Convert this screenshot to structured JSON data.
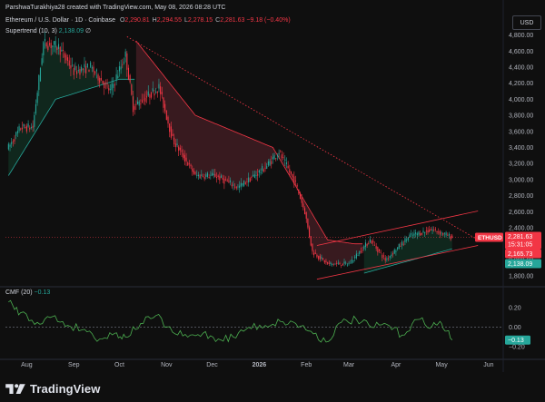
{
  "header": {
    "created_by": "ParshwaTurakhiya28 created with TradingView.com, May 08, 2026 08:28 UTC",
    "symbol_title": "Ethereum / U.S. Dollar · 1D · Coinbase",
    "ohlc": [
      {
        "key": "O",
        "value": "2,290.81"
      },
      {
        "key": "H",
        "value": "2,294.55"
      },
      {
        "key": "L",
        "value": "2,278.15"
      },
      {
        "key": "C",
        "value": "2,281.63"
      }
    ],
    "change": "−9.18 (−0.40%)",
    "supertrend_label": "Supertrend (10, 3)",
    "supertrend_value": "2,138.09",
    "supertrend_icon": "∅",
    "cmf_label": "CMF (20)",
    "cmf_value": "−0.13"
  },
  "currency": "USD",
  "brand": {
    "name": "TradingView",
    "icon": "tradingview-logo"
  },
  "colors": {
    "background": "#0f0f0f",
    "up": "#26a69a",
    "down": "#f23645",
    "supertrend_down_fill": "#3d1c21",
    "supertrend_up_fill": "#112a1f",
    "cmf_line": "#4caf50",
    "channel": "#f23645",
    "trendline": "#f23645",
    "grid": "#1f1f1f"
  },
  "chart_data": [
    {
      "type": "candlestick",
      "title": "Ethereum / U.S. Dollar · 1D · Coinbase",
      "x_ticks": [
        "Aug",
        "Sep",
        "Oct",
        "Nov",
        "Dec",
        "2026",
        "Feb",
        "Mar",
        "Apr",
        "May",
        "Jun"
      ],
      "y_ticks": [
        "1,800.00",
        "2,000.00",
        "2,200.00",
        "2,400.00",
        "2,600.00",
        "2,800.00",
        "3,000.00",
        "3,200.00",
        "3,400.00",
        "3,600.00",
        "3,800.00",
        "4,000.00",
        "4,200.00",
        "4,400.00",
        "4,600.00",
        "4,800.00"
      ],
      "ylim": [
        1700,
        4920
      ],
      "grid": false,
      "path_dates": [
        "2025-07-20",
        "2025-07-28",
        "2025-08-05",
        "2025-08-12",
        "2025-08-22",
        "2025-09-01",
        "2025-09-12",
        "2025-09-25",
        "2025-10-05",
        "2025-10-10",
        "2025-10-27",
        "2025-11-05",
        "2025-11-20",
        "2025-12-03",
        "2025-12-18",
        "2026-01-05",
        "2026-01-14",
        "2026-01-25",
        "2026-01-31",
        "2026-02-05",
        "2026-02-15",
        "2026-03-01",
        "2026-03-15",
        "2026-03-25",
        "2026-04-10",
        "2026-04-25",
        "2026-05-08"
      ],
      "path_close": [
        3400,
        3650,
        3650,
        4700,
        4650,
        4350,
        4400,
        4100,
        4550,
        3900,
        4150,
        3500,
        3050,
        3050,
        2900,
        3150,
        3350,
        2950,
        2600,
        2100,
        1950,
        1950,
        2250,
        2000,
        2300,
        2380,
        2281.63
      ],
      "supertrend": [
        {
          "date": "2025-07-20",
          "value": 3050,
          "trend": "up"
        },
        {
          "date": "2025-08-20",
          "value": 4000,
          "trend": "up"
        },
        {
          "date": "2025-10-01",
          "value": 4250,
          "trend": "up"
        },
        {
          "date": "2025-10-11",
          "value": 4750,
          "trend": "down"
        },
        {
          "date": "2025-11-20",
          "value": 3800,
          "trend": "down"
        },
        {
          "date": "2026-01-10",
          "value": 3400,
          "trend": "down"
        },
        {
          "date": "2026-02-15",
          "value": 2250,
          "trend": "down"
        },
        {
          "date": "2026-03-05",
          "value": 2200,
          "trend": "down"
        },
        {
          "date": "2026-03-10",
          "value": 1830,
          "trend": "up"
        },
        {
          "date": "2026-05-08",
          "value": 2138.09,
          "trend": "up"
        }
      ],
      "trendline": {
        "from": {
          "date": "2025-10-06",
          "value": 4780
        },
        "to": {
          "date": "2026-05-25",
          "value": 2250
        }
      },
      "channel": {
        "upper": [
          {
            "date": "2026-02-08",
            "value": 2180
          },
          {
            "date": "2026-05-25",
            "value": 2610
          }
        ],
        "lower": [
          {
            "date": "2026-02-08",
            "value": 1760
          },
          {
            "date": "2026-05-25",
            "value": 2180
          }
        ]
      },
      "price_labels": [
        {
          "text": "ETHUSD",
          "value": 2281.63,
          "color": "#f23645"
        },
        {
          "text": "2,281.63",
          "value": 2281.63,
          "color": "#f23645"
        },
        {
          "text": "15:31:05",
          "value": 2281.63,
          "color": "#f23645"
        },
        {
          "text": "2,165.73",
          "value": 2165.73,
          "color": "#f23645"
        },
        {
          "text": "2,138.09",
          "value": 2138.09,
          "color": "#26a69a"
        }
      ]
    },
    {
      "type": "line",
      "title": "CMF (20)",
      "y_ticks": [
        "−0.20",
        "0.00",
        "0.20"
      ],
      "ylim": [
        -0.3,
        0.36
      ],
      "zero_line": 0,
      "series": [
        {
          "name": "CMF (20)",
          "dates": [
            "2025-07-20",
            "2025-07-28",
            "2025-08-08",
            "2025-08-18",
            "2025-08-28",
            "2025-09-08",
            "2025-09-18",
            "2025-09-28",
            "2025-10-05",
            "2025-10-15",
            "2025-10-25",
            "2025-11-05",
            "2025-11-15",
            "2025-11-25",
            "2025-12-05",
            "2025-12-15",
            "2025-12-25",
            "2026-01-05",
            "2026-01-15",
            "2026-01-25",
            "2026-02-04",
            "2026-02-14",
            "2026-02-24",
            "2026-03-06",
            "2026-03-16",
            "2026-03-26",
            "2026-04-05",
            "2026-04-15",
            "2026-04-25",
            "2026-05-01",
            "2026-05-08"
          ],
          "values": [
            0.26,
            0.15,
            0.05,
            0.11,
            0.02,
            -0.02,
            -0.12,
            -0.06,
            -0.1,
            0.04,
            0.12,
            -0.05,
            -0.1,
            -0.06,
            -0.12,
            -0.1,
            0.0,
            0.02,
            0.06,
            0.04,
            -0.04,
            -0.15,
            0.05,
            0.08,
            0.0,
            0.03,
            -0.08,
            0.08,
            0.02,
            0.04,
            -0.13
          ]
        }
      ],
      "price_labels": [
        {
          "text": "−0.13",
          "value": -0.13,
          "color": "#26a69a"
        }
      ]
    }
  ]
}
